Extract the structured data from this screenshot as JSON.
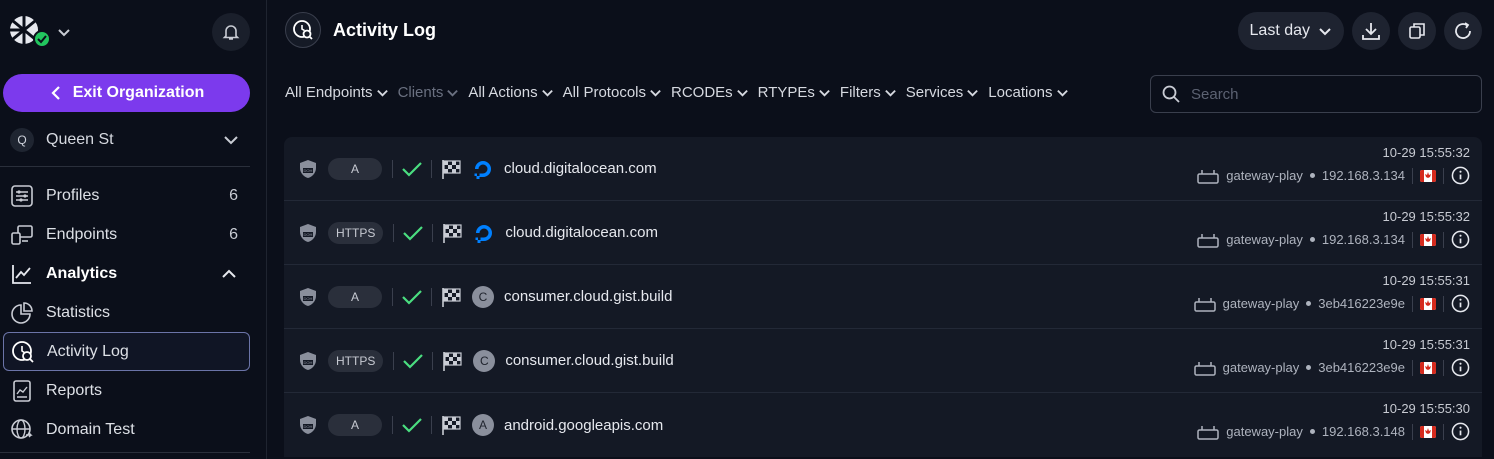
{
  "sidebar": {
    "exit_label": "Exit Organization",
    "org": {
      "initial": "Q",
      "name": "Queen St"
    },
    "nav": [
      {
        "key": "profiles",
        "label": "Profiles",
        "count": "6",
        "icon": "sliders-icon"
      },
      {
        "key": "endpoints",
        "label": "Endpoints",
        "count": "6",
        "icon": "devices-icon"
      },
      {
        "key": "analytics",
        "label": "Analytics",
        "icon": "chart-line-icon"
      },
      {
        "key": "statistics",
        "label": "Statistics",
        "icon": "pie-chart-icon"
      },
      {
        "key": "activity-log",
        "label": "Activity Log",
        "icon": "log-search-icon"
      },
      {
        "key": "reports",
        "label": "Reports",
        "icon": "report-icon"
      },
      {
        "key": "domain-test",
        "label": "Domain Test",
        "icon": "globe-icon"
      }
    ]
  },
  "header": {
    "title": "Activity Log",
    "range_label": "Last day"
  },
  "filters": [
    "All Endpoints",
    "Clients",
    "All Actions",
    "All Protocols",
    "RCODEs",
    "RTYPEs",
    "Filters",
    "Services",
    "Locations"
  ],
  "search": {
    "placeholder": "Search"
  },
  "colors": {
    "accent": "#7c3aed",
    "success": "#4ade80",
    "do_blue": "#0080ff"
  },
  "rows": [
    {
      "qtype": "A",
      "domain": "cloud.digitalocean.com",
      "favicon": "do",
      "time": "10-29 15:55:32",
      "endpoint": "gateway-play",
      "ip": "192.168.3.134"
    },
    {
      "qtype": "HTTPS",
      "domain": "cloud.digitalocean.com",
      "favicon": "do",
      "time": "10-29 15:55:32",
      "endpoint": "gateway-play",
      "ip": "192.168.3.134"
    },
    {
      "qtype": "A",
      "domain": "consumer.cloud.gist.build",
      "favicon": "C",
      "time": "10-29 15:55:31",
      "endpoint": "gateway-play",
      "ip": "3eb416223e9e"
    },
    {
      "qtype": "HTTPS",
      "domain": "consumer.cloud.gist.build",
      "favicon": "C",
      "time": "10-29 15:55:31",
      "endpoint": "gateway-play",
      "ip": "3eb416223e9e"
    },
    {
      "qtype": "A",
      "domain": "android.googleapis.com",
      "favicon": "A",
      "time": "10-29 15:55:30",
      "endpoint": "gateway-play",
      "ip": "192.168.3.148"
    }
  ]
}
